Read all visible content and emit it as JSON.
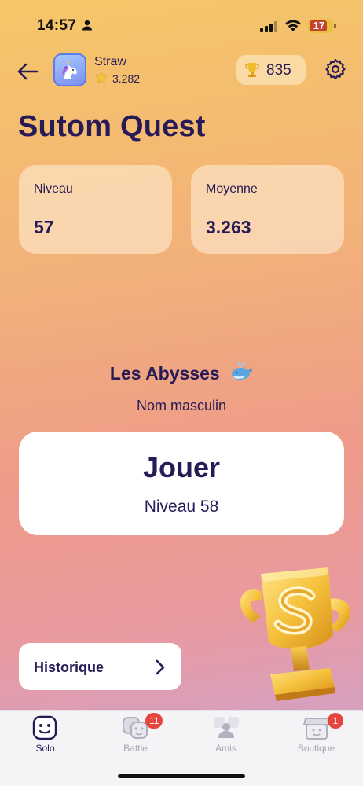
{
  "status_bar": {
    "time": "14:57",
    "battery": "17"
  },
  "header": {
    "username": "Straw",
    "rating": "3.282",
    "coins": "835"
  },
  "page_title": "Sutom Quest",
  "stats": [
    {
      "label": "Niveau",
      "value": "57"
    },
    {
      "label": "Moyenne",
      "value": "3.263"
    }
  ],
  "level": {
    "name": "Les Abysses",
    "hint": "Nom masculin"
  },
  "play_button": {
    "label": "Jouer",
    "level": "Niveau 58"
  },
  "history_button": {
    "label": "Historique"
  },
  "tabs": [
    {
      "label": "Solo",
      "icon": "smiley-icon",
      "badge": ""
    },
    {
      "label": "Battle",
      "icon": "battle-faces-icon",
      "badge": "11"
    },
    {
      "label": "Amis",
      "icon": "friends-icon",
      "badge": ""
    },
    {
      "label": "Boutique",
      "icon": "shop-icon",
      "badge": "1"
    }
  ],
  "colors": {
    "text": "#261a57",
    "badge": "#e5453d",
    "battery": "#e8c13f"
  }
}
